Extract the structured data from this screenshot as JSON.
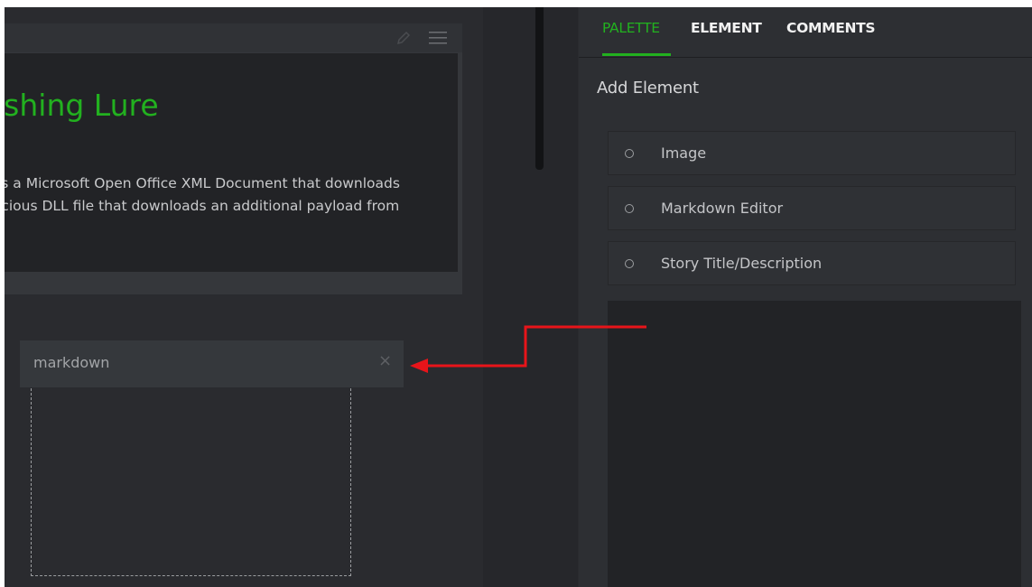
{
  "story": {
    "title": "ishing Lure",
    "description_lines": [
      "is a Microsoft Open Office XML Document that downloads",
      "icious DLL file that downloads an additional payload from"
    ]
  },
  "markdown_element": {
    "label": "markdown",
    "close_glyph": "×"
  },
  "side_panel": {
    "tabs": [
      {
        "label": "PALETTE",
        "active": true
      },
      {
        "label": "ELEMENT",
        "active": false
      },
      {
        "label": "COMMENTS",
        "active": false
      }
    ],
    "section_title": "Add Element",
    "items": [
      {
        "label": "Image",
        "icon": "radio-icon"
      },
      {
        "label": "Markdown Editor",
        "icon": "radio-icon"
      },
      {
        "label": "Story Title/Description",
        "icon": "radio-icon"
      }
    ]
  },
  "colors": {
    "accent_green": "#22b11f",
    "annotation_red": "#e8141a",
    "background": "#2a2b2f"
  }
}
